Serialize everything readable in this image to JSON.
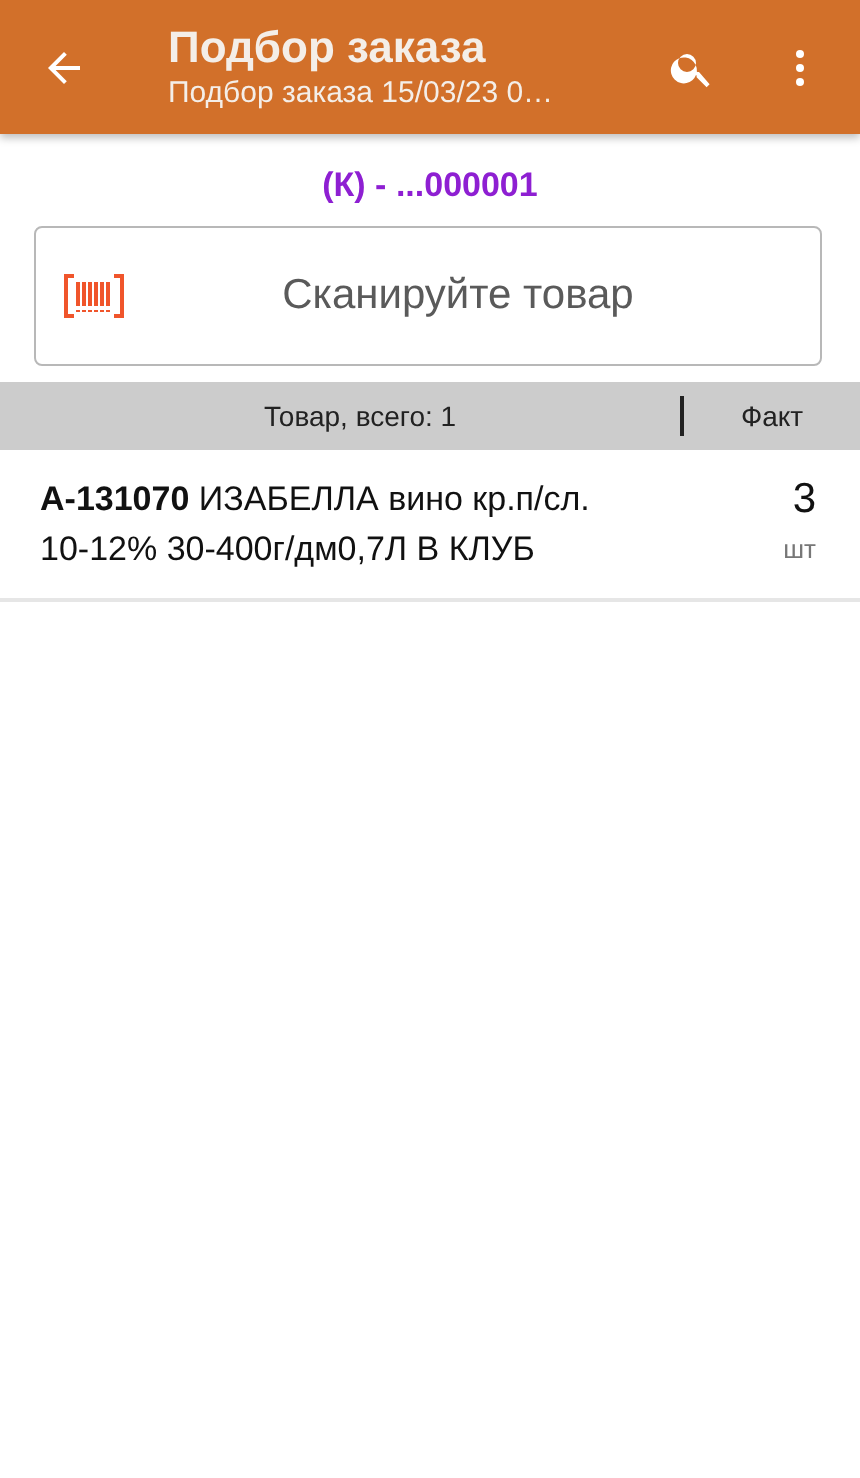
{
  "app_bar": {
    "title": "Подбор заказа",
    "subtitle": "Подбор заказа 15/03/23 0…"
  },
  "document": "(К) - ...000001",
  "scan_field": {
    "placeholder": "Сканируйте товар"
  },
  "table": {
    "columns": [
      "Товар, всего: 1",
      "Факт"
    ],
    "rows": [
      {
        "name": "**А-131070** ИЗАБЕЛЛА вино кр.п/сл. 10-12% 30-400г/дм0,7Л В КЛУБ",
        "quantity": "3",
        "unit": "шт"
      }
    ]
  }
}
